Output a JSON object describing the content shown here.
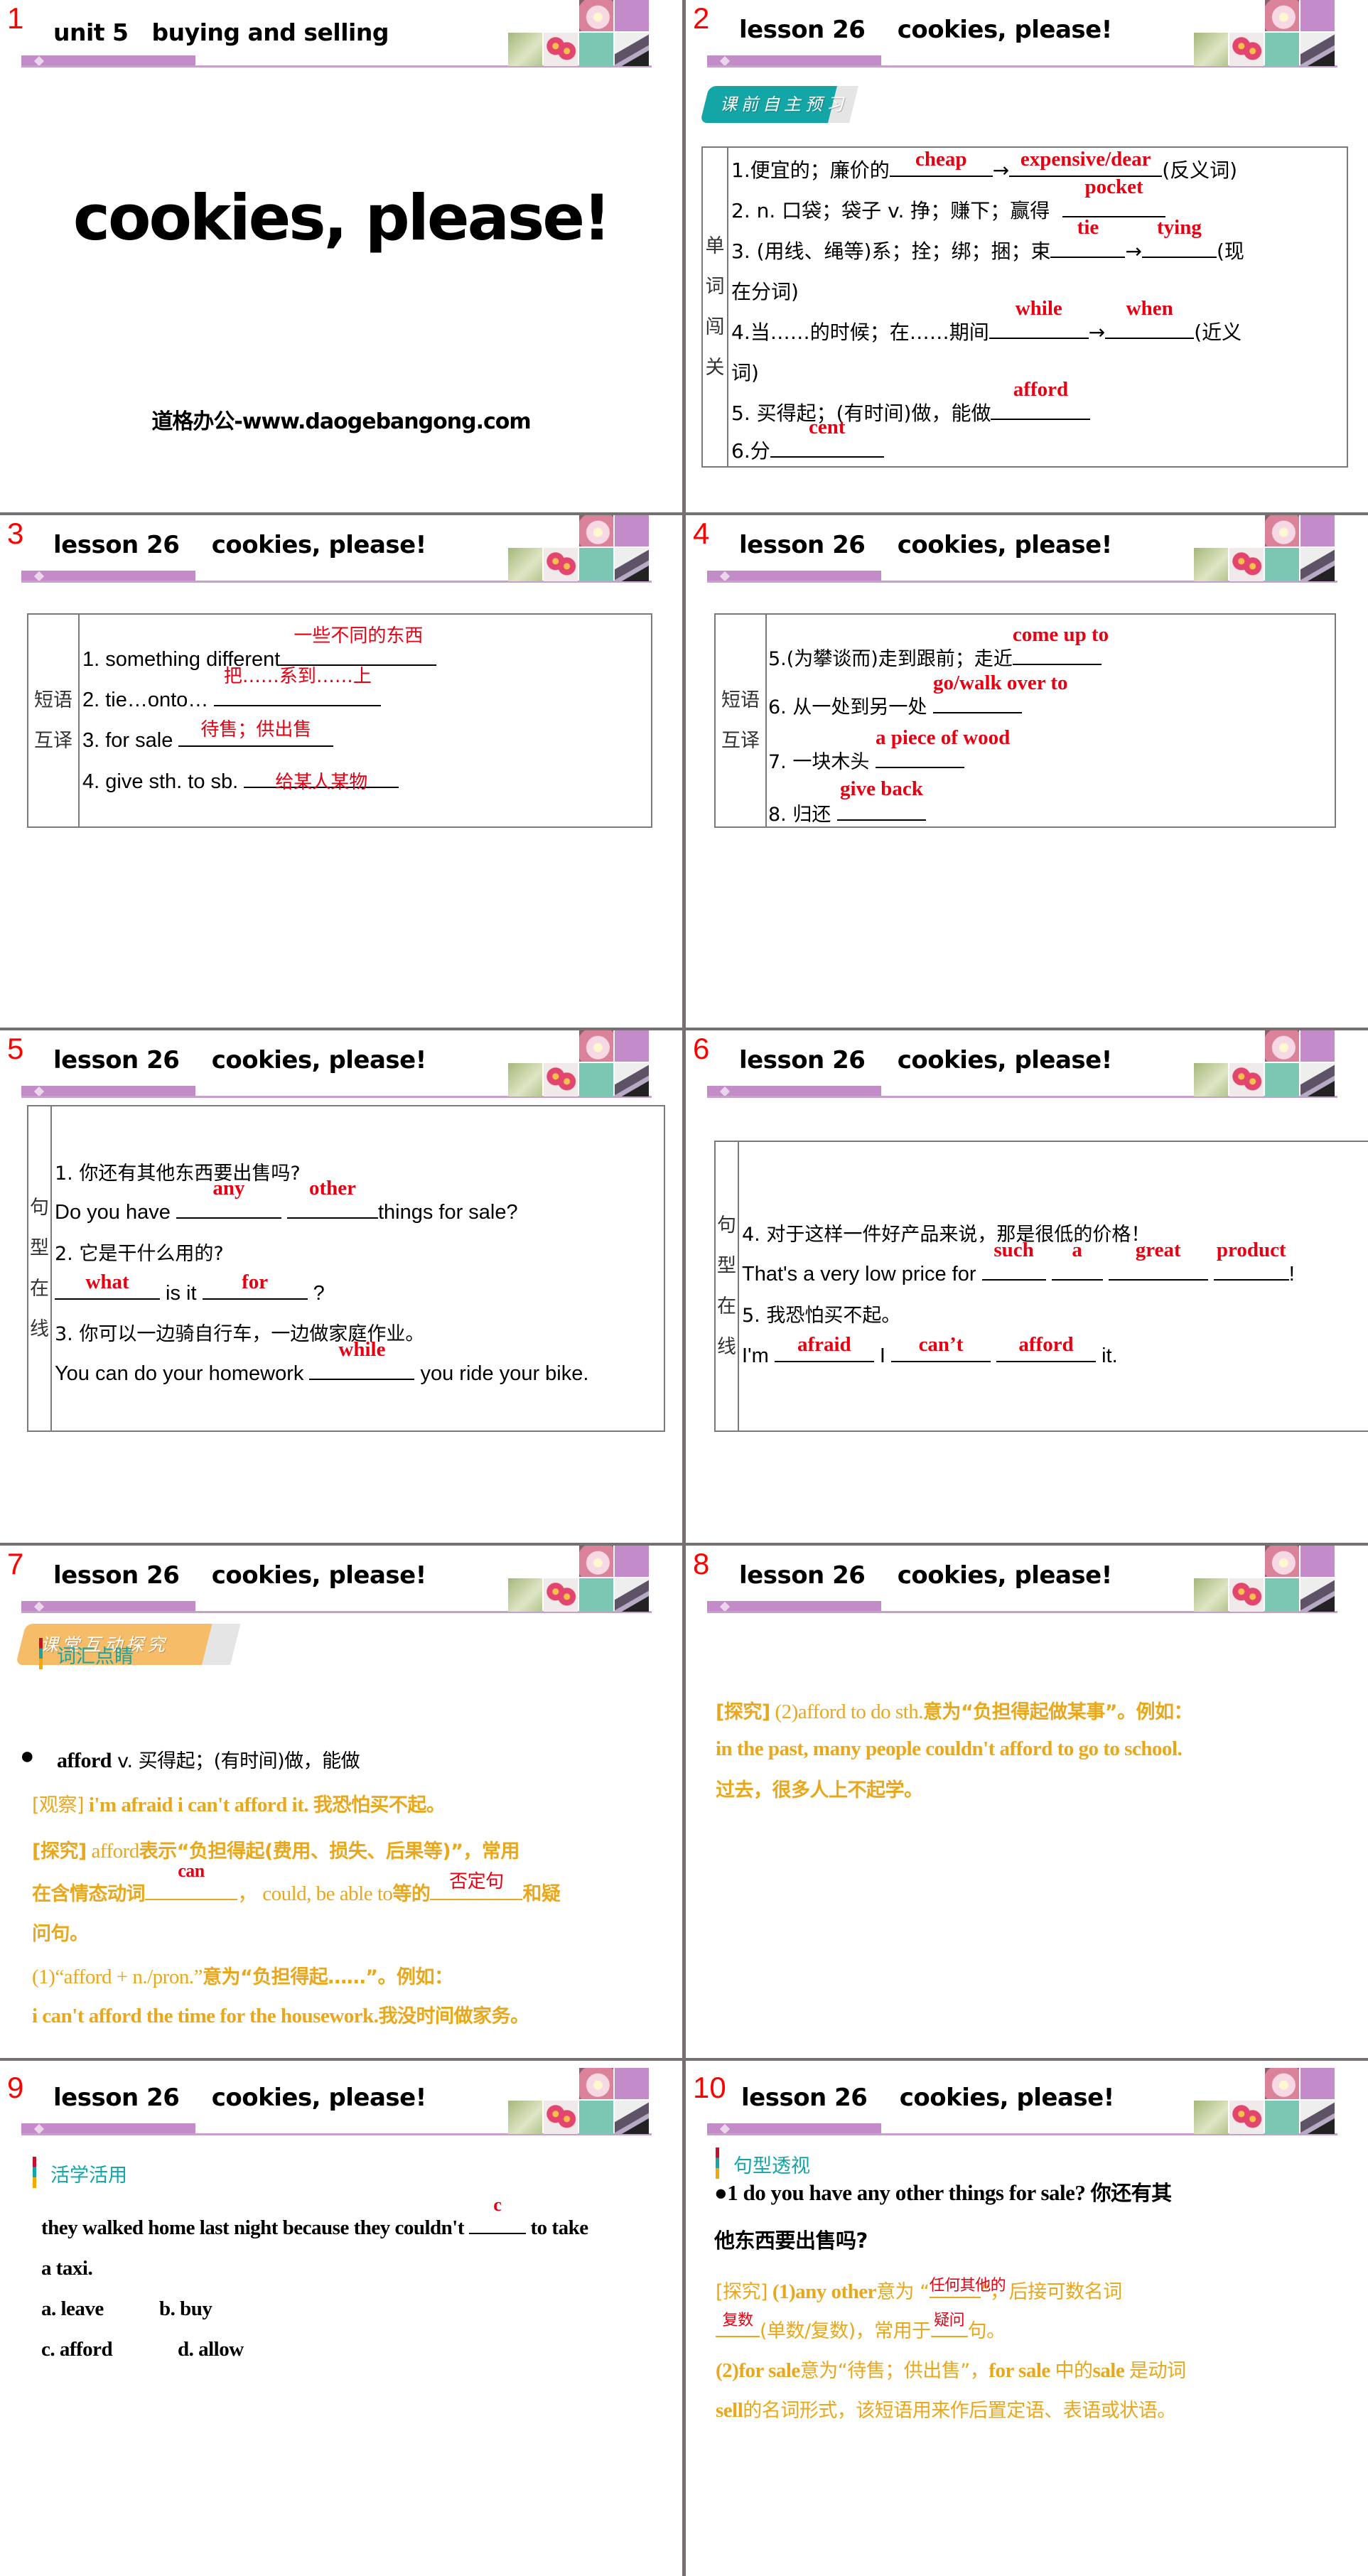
{
  "colors": {
    "slide_number": "#ff0000",
    "answer": "#e60012",
    "explanation": "#e9a81b",
    "section_teal": "#14a5a6",
    "header_bar": "#c48bc9",
    "divider": "#767171"
  },
  "slides": [
    {
      "number": "1",
      "header": "unit 5   buying and selling",
      "title": "cookies, please!",
      "subtitle": "道格办公-www.daogebangong.com"
    },
    {
      "number": "2",
      "header": "lesson 26    cookies, please!",
      "ribbon": "课前自主预习",
      "side_label": [
        "单",
        "词",
        "闯",
        "关"
      ],
      "rows": [
        {
          "prefix": "1.便宜的；廉价的",
          "answers": [
            "cheap",
            "expensive/dear"
          ],
          "arrow": "→",
          "suffix": "(反义词)"
        },
        {
          "prefix": "2. n.  口袋；袋子 v.  挣；赚下；赢得",
          "answers": [
            "pocket"
          ]
        },
        {
          "prefix": "3. (用线、绳等)系；拴；绑；捆；束",
          "answers": [
            "tie",
            "tying"
          ],
          "arrow": "→",
          "suffix": "(现",
          "continuation": "在分词)"
        },
        {
          "prefix": "4.当……的时候；在……期间",
          "answers": [
            "while",
            "when"
          ],
          "arrow": "→",
          "suffix": "(近义",
          "continuation": "词)"
        },
        {
          "prefix": "5.  买得起；(有时间)做，能做",
          "answers": [
            "afford"
          ]
        },
        {
          "prefix": "6.分",
          "answers": [
            "cent"
          ]
        }
      ]
    },
    {
      "number": "3",
      "header": "lesson 26    cookies, please!",
      "side_label": [
        "短语",
        "互译"
      ],
      "rows": [
        {
          "prefix": "1. something different",
          "answer": "一些不同的东西"
        },
        {
          "prefix": "2. tie…onto… ",
          "answer": "把……系到……上"
        },
        {
          "prefix": "3. for sale ",
          "answer": "待售；供出售"
        },
        {
          "prefix": "4. give sth. to sb. ",
          "answer": "给某人某物"
        }
      ]
    },
    {
      "number": "4",
      "header": "lesson 26    cookies, please!",
      "side_label": [
        "短语",
        "互译"
      ],
      "rows": [
        {
          "prefix": "5.(为攀谈而)走到跟前；走近",
          "answer": "come up to"
        },
        {
          "prefix": "6. 从一处到另一处 ",
          "answer": "go/walk over to"
        },
        {
          "prefix": "7. 一块木头 ",
          "answer": "a piece of wood"
        },
        {
          "prefix": "8. 归还 ",
          "answer": "give back"
        }
      ]
    },
    {
      "number": "5",
      "header": "lesson 26    cookies, please!",
      "side_label": [
        "句",
        "型",
        "在",
        "线"
      ],
      "q1_cn": "1. 你还有其他东西要出售吗?",
      "q1_en_prefix": "Do you have ",
      "q1_answers": [
        "any",
        "other"
      ],
      "q1_en_suffix": "things for sale?",
      "q2_cn": "2. 它是干什么用的?",
      "q2_answers": [
        "what",
        "for"
      ],
      "q2_mid": " is it ",
      "q2_end": " ?",
      "q3_cn": "3. 你可以一边骑自行车，一边做家庭作业。",
      "q3_en_prefix": "You can do your homework ",
      "q3_answer": "while",
      "q3_en_suffix": " you ride your bike."
    },
    {
      "number": "6",
      "header": "lesson 26    cookies, please!",
      "side_label": [
        "句",
        "型",
        "在",
        "线"
      ],
      "q4_cn": "4. 对于这样一件好产品来说，那是很低的价格！",
      "q4_en_prefix": "That's a very low price for ",
      "q4_answers": [
        "such",
        "a",
        "great",
        "product"
      ],
      "q4_end": "!",
      "q5_cn": "5. 我恐怕买不起。",
      "q5_en_prefix": "I'm ",
      "q5_answers": [
        "afraid",
        "can’t",
        "afford"
      ],
      "q5_mid": " I ",
      "q5_end": " it."
    },
    {
      "number": "7",
      "header": "lesson 26    cookies, please!",
      "ribbon": "课堂互动探究",
      "section": "词汇点睛",
      "bullet_word": "afford",
      "bullet_def": " v. 买得起；(有时间)做，能做",
      "observe_tag": "[观察]",
      "observe_en": " i'm afraid i can't afford it. ",
      "observe_cn": "我恐怕买不起。",
      "explore_tag": "[探究]",
      "explore_1a": " afford",
      "explore_1b": "表示“负担得起(费用、损失、后果等)”，常用",
      "explore_2a": "在含情态动词",
      "explore_2_ans1": "can",
      "explore_2b": "，  could, be able to",
      "explore_2c": "等的",
      "explore_2_ans2": "否定句",
      "explore_2d": "和疑",
      "explore_3": "问句。",
      "point1_en": "(1)“afford + n./pron.”",
      "point1_cn": "意为“负担得起……”。例如：",
      "example_en": "i can't afford the time for the housework.",
      "example_cn": "我没时间做家务。"
    },
    {
      "number": "8",
      "header": "lesson 26    cookies, please!",
      "explore_tag": "[探究]",
      "explore_en": " (2)afford to do sth.",
      "explore_cn": "意为“负担得起做某事”。例如：",
      "example_en": "in the past, many people couldn't afford to go to school.",
      "example_cn": "过去，很多人上不起学。"
    },
    {
      "number": "9",
      "header": "lesson 26    cookies, please!",
      "section": "活学活用",
      "question_a": "they walked home last night because they couldn't ",
      "answer": "c",
      "question_b": " to take",
      "question_c": "a taxi.",
      "options": [
        "a. leave",
        "b. buy",
        "c. afford",
        "d. allow"
      ]
    },
    {
      "number": "10",
      "header": "lesson 26    cookies, please!",
      "section": "句型透视",
      "point_en": "●1    do you have any other things for sale? ",
      "point_cn_a": "你还有其",
      "point_cn_b": "他东西要出售吗?",
      "explore_tag": "[探究]",
      "explore_1": " (1)any other",
      "explore_1b": "意为 “",
      "explore_ans1": "任何其他的",
      "explore_1c": "”，后接可数名词",
      "explore_ans2": "复数",
      "explore_2": "(单数/复数)，常用于",
      "explore_ans3": "疑问",
      "explore_2b": "句。",
      "explore_3a": "(2)for sale",
      "explore_3b": "意为“待售；供出售”，",
      "explore_3c": "for sale ",
      "explore_3d": "中的",
      "explore_3e": "sale ",
      "explore_3f": "是动词",
      "explore_4a": "sell",
      "explore_4b": "的名词形式，该短语用来作后置定语、表语或状语。"
    }
  ]
}
